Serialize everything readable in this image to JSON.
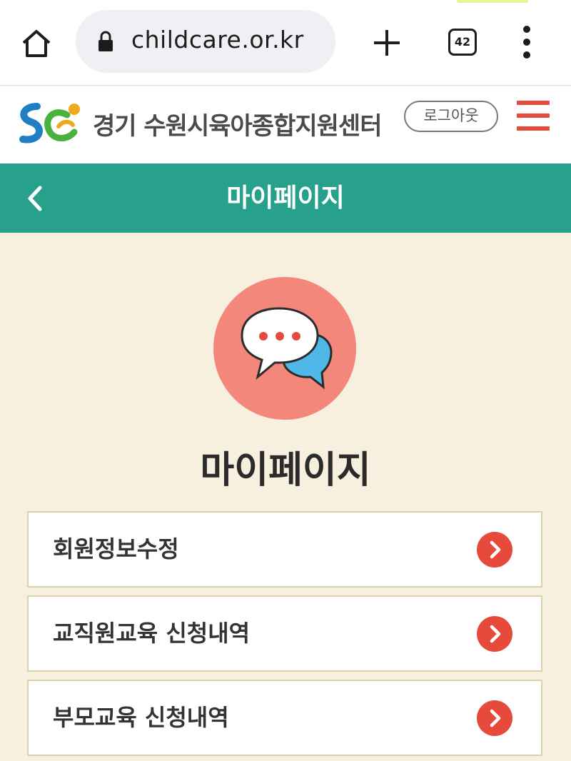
{
  "browser": {
    "url": "childcare.or.kr",
    "tab_count": "42",
    "icons": [
      "home-icon",
      "lock-icon",
      "plus-icon",
      "tab-switcher-icon",
      "more-vert-icon"
    ]
  },
  "site_header": {
    "org_name": "경기 수원시육아종합지원센터",
    "logout_label": "로그아웃",
    "brand_colors": {
      "accent": "#e64a3b",
      "teal": "#27a18c"
    }
  },
  "title_bar": {
    "title": "마이페이지"
  },
  "main": {
    "heading": "마이페이지",
    "menu": [
      {
        "label": "회원정보수정"
      },
      {
        "label": "교직원교육 신청내역"
      },
      {
        "label": "부모교육 신청내역"
      }
    ]
  }
}
